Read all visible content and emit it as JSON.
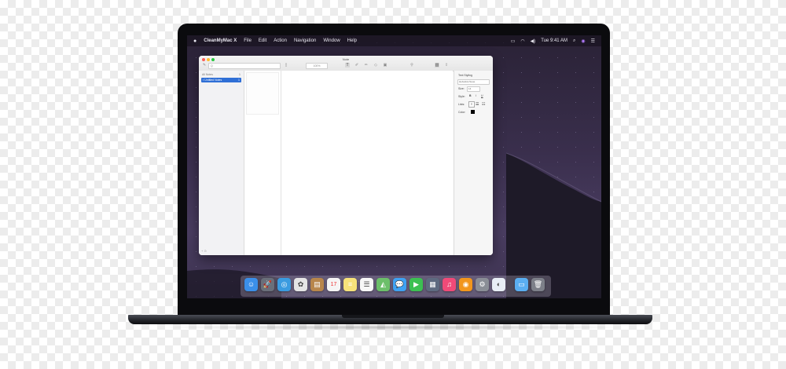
{
  "menubar": {
    "apple_icon": "",
    "app_name": "CleanMyMac X",
    "items": [
      "File",
      "Edit",
      "Action",
      "Navigation",
      "Window",
      "Help"
    ],
    "clock": "Tue 9:41 AM"
  },
  "notes_window": {
    "title": "Note",
    "search_placeholder": "Q",
    "zoom": "100%",
    "sidebar": {
      "header": "All Notes",
      "header_count": "1",
      "selected_item": "Untitled Notes",
      "selected_count": "1",
      "footer": "+ ⊙"
    },
    "inspector": {
      "title": "Text Styling",
      "font": "Helvetica Neue",
      "size_label": "Size:",
      "size_value": "14",
      "style_label": "Style:",
      "style_buttons": [
        "B",
        "I",
        "U"
      ],
      "lists_label": "Lists:",
      "color_label": "Color:"
    }
  },
  "dock": {
    "items": [
      {
        "name": "finder",
        "glyph": "☺",
        "color": "#3b8fe8"
      },
      {
        "name": "launchpad",
        "glyph": "🚀",
        "color": "#6a6f7a"
      },
      {
        "name": "safari",
        "glyph": "◎",
        "color": "#3a9be0"
      },
      {
        "name": "photos",
        "glyph": "✿",
        "color": "#e5e5e5"
      },
      {
        "name": "contacts",
        "glyph": "▤",
        "color": "#b8864b"
      },
      {
        "name": "calendar",
        "glyph": "17",
        "color": "#f5f5f5"
      },
      {
        "name": "notes",
        "glyph": "≡",
        "color": "#f6e27a"
      },
      {
        "name": "reminders",
        "glyph": "☰",
        "color": "#f7f7f7"
      },
      {
        "name": "maps",
        "glyph": "◭",
        "color": "#6cbf6a"
      },
      {
        "name": "messages",
        "glyph": "💬",
        "color": "#3fa2f2"
      },
      {
        "name": "facetime",
        "glyph": "▶",
        "color": "#3cc052"
      },
      {
        "name": "photo-booth",
        "glyph": "▦",
        "color": "#5e6a80"
      },
      {
        "name": "music",
        "glyph": "♫",
        "color": "#f04a78"
      },
      {
        "name": "books",
        "glyph": "◉",
        "color": "#f2961c"
      },
      {
        "name": "system-preferences",
        "glyph": "⚙",
        "color": "#8a8e96"
      },
      {
        "name": "cleanmymac",
        "glyph": "◐",
        "color": "#e8eef5"
      },
      {
        "name": "downloads-folder",
        "glyph": "▭",
        "color": "#5aaef0"
      },
      {
        "name": "trash",
        "glyph": "🗑",
        "color": "#7d8089"
      }
    ]
  },
  "colors": {
    "accent": "#2f6fd6",
    "wallpaper_top": "#2a2236",
    "wallpaper_bottom": "#4a3d61",
    "dune": "#1e1a28"
  }
}
